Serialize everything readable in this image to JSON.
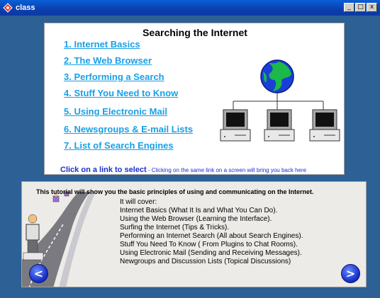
{
  "window": {
    "title": "class",
    "controls": {
      "minimize": "_",
      "maximize": "□",
      "close": "x"
    }
  },
  "top": {
    "title": "Searching the Internet",
    "links": [
      "1. Internet Basics",
      "2. The Web Browser",
      "3. Performing a Search",
      "4. Stuff You Need to Know",
      "5. Using Electronic Mail",
      "6. Newsgroups & E-mail Lists",
      "7. List of Search Engines"
    ],
    "footer_bold": "Click on a link to select",
    "footer_small": " - Clicking on the same link on a screen will bring you back here"
  },
  "bottom": {
    "intro": "This tutorial will show you the basic principles of using and communicating on the Internet.",
    "cover_lines": [
      "It will cover:",
      "Internet Basics (What It Is and What You Can Do).",
      "Using the Web Browser (Learning the Interface).",
      "Surfing the Internet (Tips & Tricks).",
      "Performing an Internet Search (All about Search Engines).",
      "Stuff You Need To Know ( From Plugins to Chat Rooms).",
      "Using Electronic Mail (Sending and Receiving Messages).",
      "Newgroups and Discussion Lists (Topical Discussions)"
    ],
    "prev_icon": "<",
    "next_icon": ">"
  },
  "colors": {
    "background": "#2d6094",
    "link": "#19a0e6",
    "footer": "#1a2fd0",
    "nav_button": "#1730c9"
  },
  "icons": [
    "app-icon",
    "globe-icon",
    "computer-icon",
    "left-arrow-icon",
    "right-arrow-icon"
  ]
}
